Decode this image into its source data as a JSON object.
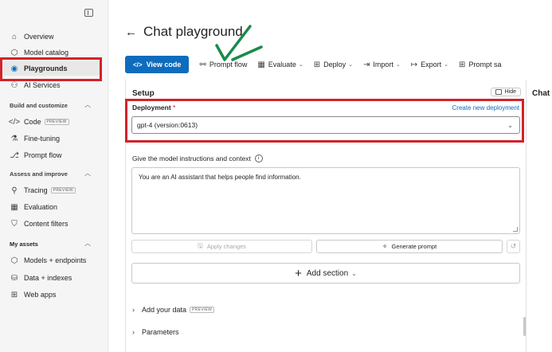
{
  "sidebar": {
    "toggle_icon": "panel-icon",
    "items_top": [
      {
        "label": "Overview",
        "icon": "home-icon"
      },
      {
        "label": "Model catalog",
        "icon": "cube-icon"
      },
      {
        "label": "Playgrounds",
        "icon": "playground-icon"
      },
      {
        "label": "AI Services",
        "icon": "ai-services-icon"
      }
    ],
    "section_build": "Build and customize",
    "items_build": [
      {
        "label": "Code",
        "badge": "PREVIEW",
        "icon": "code-icon"
      },
      {
        "label": "Fine-tuning",
        "icon": "flask-icon"
      },
      {
        "label": "Prompt flow",
        "icon": "flow-icon"
      }
    ],
    "section_assess": "Assess and improve",
    "items_assess": [
      {
        "label": "Tracing",
        "badge": "PREVIEW",
        "icon": "tracing-icon"
      },
      {
        "label": "Evaluation",
        "icon": "evaluation-icon"
      },
      {
        "label": "Content filters",
        "icon": "shield-icon"
      }
    ],
    "section_assets": "My assets",
    "items_assets": [
      {
        "label": "Models + endpoints",
        "icon": "cube-icon"
      },
      {
        "label": "Data + indexes",
        "icon": "database-icon"
      },
      {
        "label": "Web apps",
        "icon": "web-icon"
      }
    ]
  },
  "header": {
    "back_glyph": "←",
    "title": "Chat playground"
  },
  "toolbar": {
    "view_code": "View code",
    "prompt_flow": "Prompt flow",
    "evaluate": "Evaluate",
    "deploy": "Deploy",
    "import": "Import",
    "export": "Export",
    "prompt_samples": "Prompt sa"
  },
  "setup": {
    "title": "Setup",
    "hide": "Hide",
    "deployment_label": "Deployment",
    "required_mark": "*",
    "create_link": "Create new deployment",
    "deployment_value": "gpt-4 (version:0613)",
    "instructions_label": "Give the model instructions and context",
    "instructions_value": "You are an AI assistant that helps people find information.",
    "apply_changes": "Apply changes",
    "generate_prompt": "Generate prompt",
    "add_section": "Add section",
    "add_data": "Add your data",
    "add_data_badge": "PREVIEW",
    "parameters": "Parameters"
  },
  "chat": {
    "title": "Chat"
  },
  "colors": {
    "accent": "#0f6cbd",
    "highlight_box": "#d4222a",
    "check_mark": "#1a8a4a"
  }
}
